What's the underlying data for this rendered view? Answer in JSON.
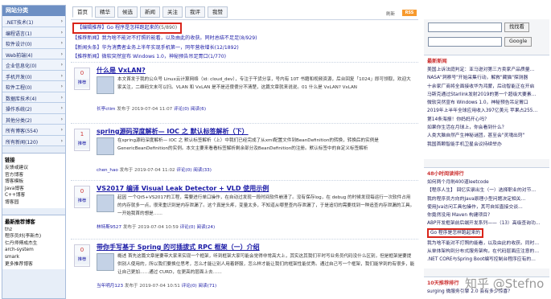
{
  "sidebar": {
    "title": "网站分类",
    "categories": [
      ".NET技术(1)",
      "编程语言(1)",
      "软件设计(0)",
      "Web前端(4)",
      "企业信息化(0)",
      "手机开发(0)",
      "软件工程(0)",
      "数据库技术(4)",
      "操作系统(2)",
      "其他分类(2)",
      "所有博客(554)",
      "所有新闻(120)"
    ],
    "links_title": "链接",
    "links": [
      "反馈或建议",
      "官方博客",
      "博客模板",
      "Java博客",
      "C++博客",
      "博客园"
    ],
    "bloggers_title": "最新推荐博客",
    "bloggers": [
      "thz",
      "程序员刘(李新杰)",
      "仁丹师傅成杰生",
      "arch-system",
      "smark",
      "更多推荐博客"
    ]
  },
  "tabs": [
    "首页",
    "精华",
    "候选",
    "新闻",
    "关注",
    "我评",
    "我赞"
  ],
  "toolbar": {
    "subscribe": "刷新",
    "rss": "RSS"
  },
  "notices": [
    {
      "text": "【编辑推荐】Go 程序是怎样跑起来的",
      "num": "(5/890)",
      "boxed": true
    },
    {
      "text": "【推荐新闻】我为啥不能对不打照的能看，以及由此的收获。同时总结不足足(8/929)",
      "num": "",
      "boxed": false
    },
    {
      "text": "【新闻头条】华为消费者业务上半年实现手机第一，同年营收增长(12/1892)",
      "num": "",
      "boxed": false
    },
    {
      "text": "【推荐新闻】微软突然宣布 Windows 1.0，神秘预告吊足胃口(1/770)",
      "num": "",
      "boxed": false
    }
  ],
  "posts": [
    {
      "votes": "0",
      "recommend": "推荐",
      "title": "什么是 VxLAN?",
      "abstract": "本文首发于我的公众号 Linux云计算网络（id: cloud_dev），专注于干货分享，号内有 10T 书籍和视频资源，后台回复「1024」即可领取，欢迎大家关注，二维码文末可以扫。VLAN 和 VxLAN 是不是还傻傻分不清楚，这篇文章就来说说。01 什么是 VxLAN? VxLAN",
      "author": "长亭ctim",
      "date": "发布于 2019-07-04 11:07",
      "comments": "评论(0)",
      "reads": "阅读(6)"
    },
    {
      "votes": "1",
      "recommend": "推荐",
      "title": "spring源码深度解析— IOC 之 默认标签解析（下）",
      "abstract": "在spring源码深度解析— IOC 之 默认标签解析（上）中我们已经完成了从xml配置文件到BeanDefinition的转换，转换后的实例是GenericBeanDefinition的实例。本文主要来看看标签解析剩余部分及BeanDefinition的注册。默认标签中的自定义标签解析",
      "author": "chen_hao",
      "date": "发布于 2019-07-04 11:02",
      "comments": "评论(0)",
      "reads": "阅读(33)"
    },
    {
      "votes": "0",
      "recommend": "推荐",
      "title": "VS2017 编译 Visual Leak Detector + VLD 使用示例",
      "abstract": "起因 一个Qt5+VS2017的工程，需要进行单口操作，在自动过发现一段时间软件崩溃了。没有保存log，在 debug 的时候发现每运行一次软件占用的内存就多一点，很来重识到是内存泄漏了。这个真是头疼，变量太多，不知道从哪里查内存泄漏了，于是追切的需要找到一种追查内存泄漏的工具。一开始我首的想是……",
      "author": "林特斯9527",
      "date": "发布于 2019-07-04 10:59",
      "comments": "评论(0)",
      "reads": "阅读(24)"
    },
    {
      "votes": "0",
      "recommend": "推荐",
      "title": "带你手写基于 Spring 的可插拔式 RPC 框架（一）介绍",
      "abstract": "概述 首先这篇文章是要带大家来实现一个框架，听到框架大家可能会觉得非常高大上，其实这其我们平时写业务员代码没什么区别，但是框架是要提供别人使用的，所以我们要换位思考，怎么才能让别人用着舒服，怎么样才能让我们的框架性能优秀。通过自己写一个框架，我们能学到的有很多，能让自己更加……通过 CURD，在更高的层面上去……",
      "author": "当年明月123",
      "date": "发布于 2019-07-04 10:51",
      "comments": "评论(0)",
      "reads": "阅读(71)"
    }
  ],
  "search": {
    "btn1": "找找看",
    "btn2": "Google"
  },
  "latest_news": {
    "title": "最新新闻",
    "items": [
      "美国上诉法庭判定：亚马逊对第三方卖家产品质量…",
      "NASA\"洞察号\"开始采集行动，解救\"藏猫\"探测器",
      "十余家厂商将全面接收华为鸿蒙，后动智能正在开启",
      "马斯克通过Starlink发射2019的第一个超级大要素…",
      "微软突然宣布 Windows 1.0，神秘预告吊足胃口",
      "2019年上半年全球应用收入397亿美元 苹果占255…",
      "第14条海报！你妈妈开心吗？",
      "如果你生活在月球上，你会看到什么？",
      "人类大脑自然产生神秘谜团，甚至会\"灵魂出窍\"",
      "我国首颗智能手机卫星会议持续举办"
    ]
  },
  "hot_posts": {
    "title": "48小时阅读排行",
    "items": [
      "如何两个月刷400道leetcode",
      "【程序人生】 回忆实录出生（一）选择职业的对节…",
      "我的程序员方向的Java原理小型问题决定相关…",
      "使用Jva访问工具包操作，其可自如直接交谈…",
      "你竟然没用 Maven 构建项目?",
      "ABP开发框架前后端开发系列——（13）高级查询功…",
      "Go 程序是怎样跑起来的",
      "我为啥不能对不打照的能看，以及由此的收获。同时…",
      "从单体架构到分布式服务架构，在代码层面应注意的…",
      ".NET CORE与Spring Boot编写控制台程序应有的…"
    ]
  },
  "recommend": {
    "title": "10天推荐排行",
    "first": "surging 微服务引擎 2.0 会有多少惊喜？"
  },
  "watermark": "知乎 @Stefno"
}
